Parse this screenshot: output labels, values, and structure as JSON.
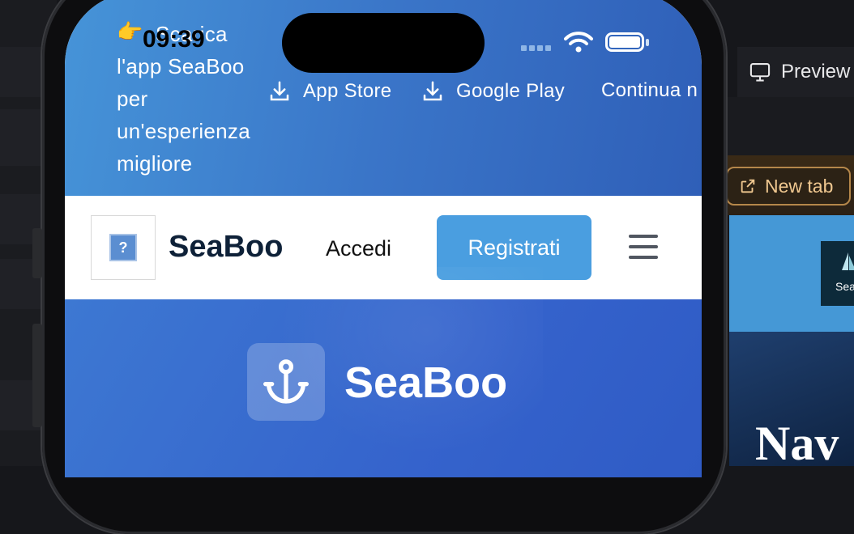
{
  "desktop": {
    "preview_label": "Preview",
    "new_tab_label": "New tab",
    "site_preview": {
      "logo_text": "Sea",
      "hero_text": "Nav"
    }
  },
  "phone": {
    "status_bar": {
      "time": "09:39",
      "icons": [
        "signal-icon",
        "wifi-icon",
        "battery-icon"
      ]
    },
    "promo_banner": {
      "emoji": "👉",
      "text_line1": "Scarica",
      "text_rest": "l'app SeaBoo per un'esperienza migliore",
      "app_store_label": "App Store",
      "google_play_label": "Google Play",
      "continue_label": "Continua n",
      "icons": [
        "download-icon"
      ]
    },
    "header": {
      "logo_placeholder": "?",
      "brand": "SeaBoo",
      "login_label": "Accedi",
      "register_label": "Registrati",
      "menu_icon": "hamburger-menu-icon"
    },
    "hero": {
      "brand": "SeaBoo",
      "icon": "anchor-icon"
    }
  },
  "colors": {
    "banner_gradient_start": "#4694d8",
    "banner_gradient_end": "#2f5fb8",
    "register_button": "#4a9ee0",
    "brand_text": "#0e2138",
    "hero_bg": "#3563cc"
  }
}
